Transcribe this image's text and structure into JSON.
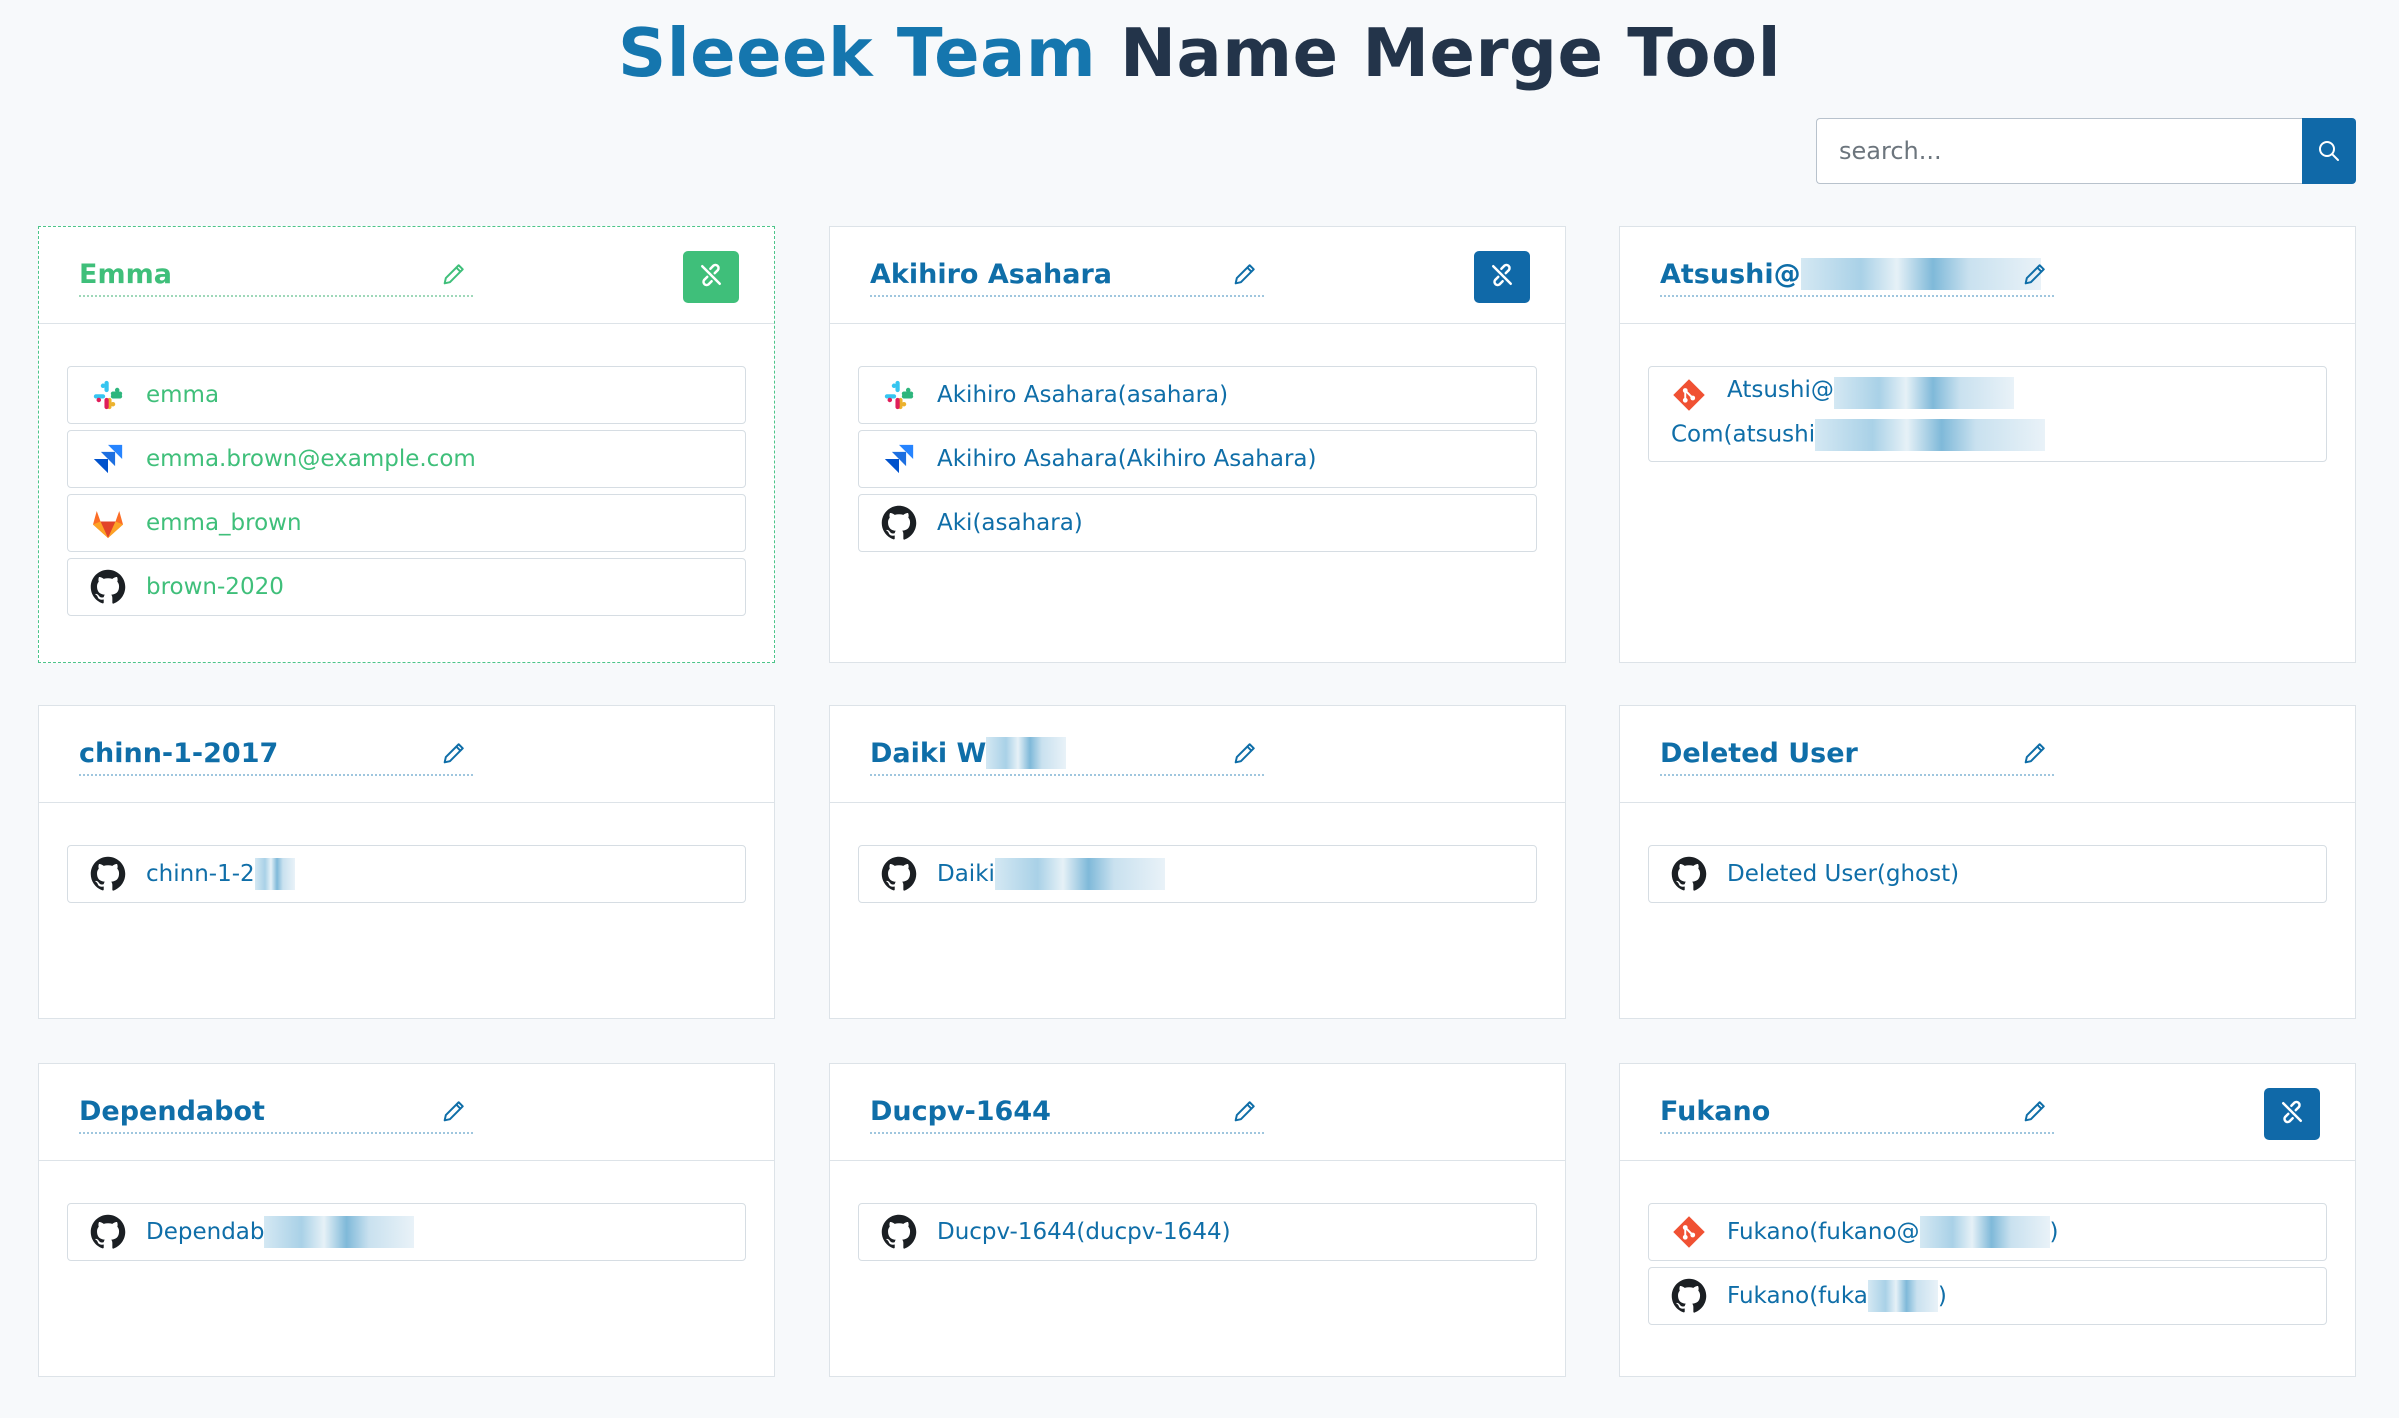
{
  "title": {
    "brand": "Sleeek Team",
    "rest": "Name Merge Tool"
  },
  "search": {
    "placeholder": "search..."
  },
  "colors": {
    "accent": "#1069a8",
    "active": "#3fbf7a",
    "title_dark": "#23344a"
  },
  "cards": [
    {
      "name": "Emma",
      "active": true,
      "unlink": true,
      "accounts": [
        {
          "service": "slack-icon",
          "label": "emma"
        },
        {
          "service": "jira-icon",
          "label": "emma.brown@example.com"
        },
        {
          "service": "gitlab-icon",
          "label": "emma_brown"
        },
        {
          "service": "github-icon",
          "label": "brown-2020"
        }
      ]
    },
    {
      "name": "Akihiro Asahara",
      "active": false,
      "unlink": true,
      "accounts": [
        {
          "service": "slack-icon",
          "label": "Akihiro Asahara(asahara)"
        },
        {
          "service": "jira-icon",
          "label": "Akihiro Asahara(Akihiro Asahara)"
        },
        {
          "service": "github-icon",
          "label": "Aki(asahara)"
        }
      ]
    },
    {
      "name": "Atsushi@",
      "active": false,
      "unlink": false,
      "accounts": [
        {
          "service": "git-icon",
          "label": "Atsushi@",
          "line2": "Com(atsushi"
        }
      ]
    },
    {
      "name": "chinn-1-2017",
      "active": false,
      "unlink": false,
      "accounts": [
        {
          "service": "github-icon",
          "label": "chinn-1-2"
        }
      ]
    },
    {
      "name": "Daiki W",
      "active": false,
      "unlink": false,
      "accounts": [
        {
          "service": "github-icon",
          "label": "Daiki"
        }
      ]
    },
    {
      "name": "Deleted User",
      "active": false,
      "unlink": false,
      "accounts": [
        {
          "service": "github-icon",
          "label": "Deleted User(ghost)"
        }
      ]
    },
    {
      "name": "Dependabot",
      "active": false,
      "unlink": false,
      "accounts": [
        {
          "service": "github-icon",
          "label": "Dependab"
        }
      ]
    },
    {
      "name": "Ducpv-1644",
      "active": false,
      "unlink": false,
      "accounts": [
        {
          "service": "github-icon",
          "label": "Ducpv-1644(ducpv-1644)"
        }
      ]
    },
    {
      "name": "Fukano",
      "active": false,
      "unlink": true,
      "accounts": [
        {
          "service": "git-icon",
          "label": "Fukano(fukano@",
          "suffix": ")"
        },
        {
          "service": "github-icon",
          "label": "Fukano(fuka",
          "suffix": ")"
        }
      ]
    }
  ]
}
